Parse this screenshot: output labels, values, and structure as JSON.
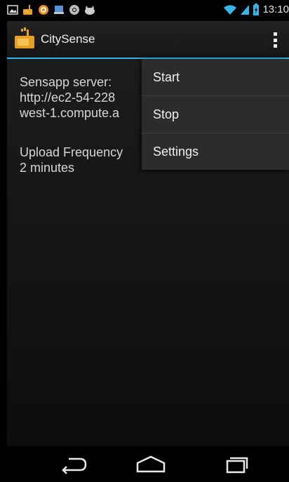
{
  "status_bar": {
    "time": "13:10",
    "notification_icons": [
      "image-icon",
      "citysense-notification-icon",
      "orange-circle-icon",
      "download-icon",
      "chrome-icon",
      "cat-icon"
    ],
    "right_icons": [
      "wifi-icon",
      "signal-icon",
      "battery-charging-icon"
    ]
  },
  "action_bar": {
    "title": "CitySense",
    "app_icon": "citysense-app-icon",
    "overflow_icon": "overflow-menu-icon"
  },
  "content": {
    "server_label": "Sensapp server:",
    "server_line1": "http://ec2-54-228",
    "server_line2": "west-1.compute.a",
    "frequency_label": "Upload Frequency",
    "frequency_value": "2 minutes"
  },
  "menu": {
    "items": [
      {
        "label": "Start"
      },
      {
        "label": "Stop"
      },
      {
        "label": "Settings"
      }
    ]
  },
  "nav_bar": {
    "back": "back-icon",
    "home": "home-icon",
    "recents": "recent-apps-icon"
  },
  "colors": {
    "accent": "#31b6e7",
    "menu_bg": "#2b2c2e",
    "text": "#d6d6d6"
  }
}
